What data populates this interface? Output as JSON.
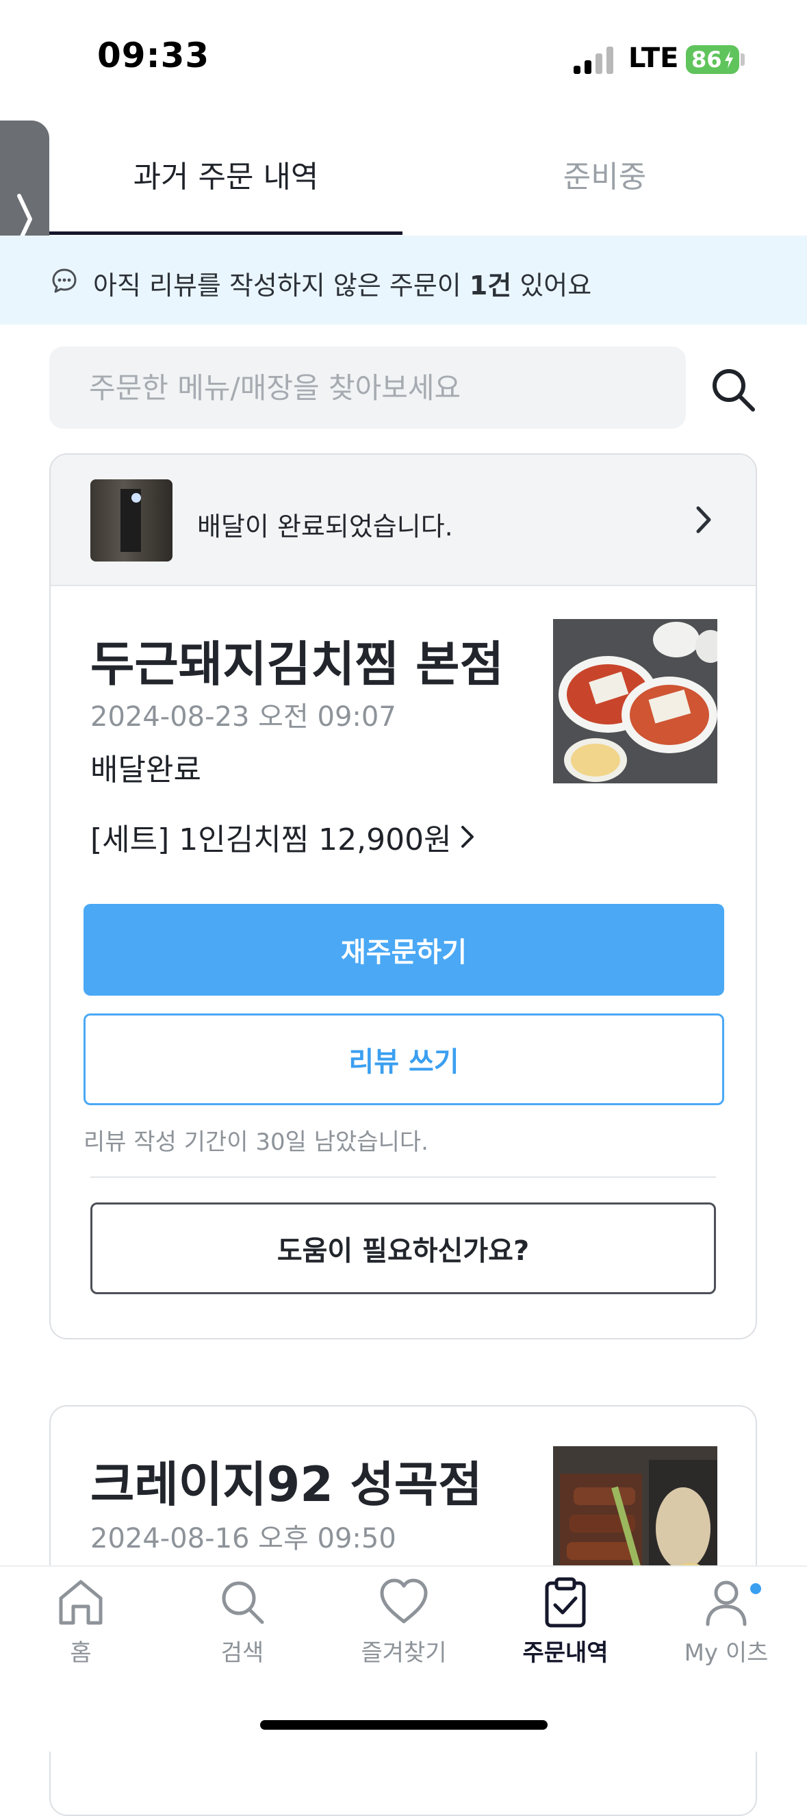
{
  "status_bar": {
    "time": "09:33",
    "network": "LTE",
    "battery": "86"
  },
  "tabs": [
    {
      "label": "과거 주문 내역",
      "active": true
    },
    {
      "label": "준비중",
      "active": false
    }
  ],
  "banner": {
    "text_before": "아직 리뷰를 작성하지 않은 주문이 ",
    "count": "1건",
    "text_after": " 있어요"
  },
  "search": {
    "placeholder": "주문한 메뉴/매장을 찾아보세요"
  },
  "orders": [
    {
      "delivery_message": "배달이 완료되었습니다.",
      "store": "두근돼지김치찜 본점",
      "date": "2024-08-23 오전 09:07",
      "status": "배달완료",
      "item": "[세트] 1인김치찜 12,900원",
      "reorder_label": "재주문하기",
      "review_label": "리뷰 쓰기",
      "review_period": "리뷰 작성 기간이 30일 남았습니다.",
      "help_label": "도움이 필요하신가요?"
    },
    {
      "store": "크레이지92 성곡점",
      "date": "2024-08-16 오후 09:50"
    }
  ],
  "bottom_nav": [
    {
      "label": "홈",
      "icon": "home-icon"
    },
    {
      "label": "검색",
      "icon": "search-icon"
    },
    {
      "label": "즐겨찾기",
      "icon": "heart-icon"
    },
    {
      "label": "주문내역",
      "icon": "clipboard-check-icon",
      "active": true
    },
    {
      "label": "My 이츠",
      "icon": "person-icon"
    }
  ],
  "colors": {
    "accent": "#4aa8f5",
    "tab_underline": "#15172b",
    "banner_bg": "#eaf6fd",
    "battery": "#5fc45b"
  }
}
